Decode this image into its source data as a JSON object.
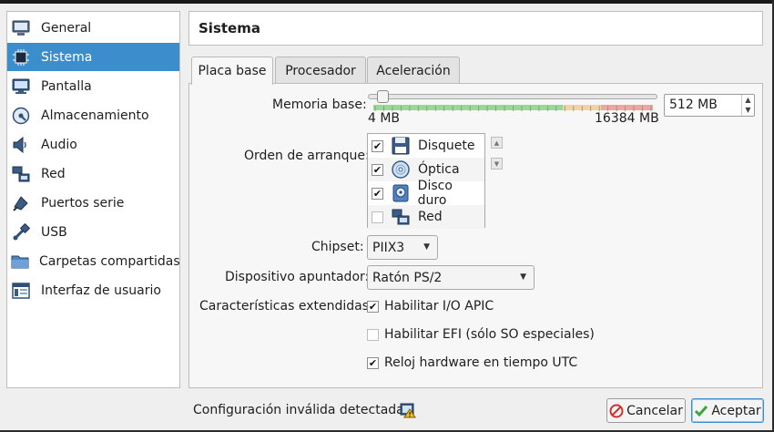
{
  "sidebar": {
    "items": [
      {
        "label": "General",
        "icon": "general-icon",
        "selected": false
      },
      {
        "label": "Sistema",
        "icon": "system-chip-icon",
        "selected": true
      },
      {
        "label": "Pantalla",
        "icon": "monitor-icon",
        "selected": false
      },
      {
        "label": "Almacenamiento",
        "icon": "storage-disk-icon",
        "selected": false
      },
      {
        "label": "Audio",
        "icon": "audio-speaker-icon",
        "selected": false
      },
      {
        "label": "Red",
        "icon": "network-icon",
        "selected": false
      },
      {
        "label": "Puertos serie",
        "icon": "serial-port-icon",
        "selected": false
      },
      {
        "label": "USB",
        "icon": "usb-icon",
        "selected": false
      },
      {
        "label": "Carpetas compartidas",
        "icon": "folder-icon",
        "selected": false
      },
      {
        "label": "Interfaz de usuario",
        "icon": "user-interface-icon",
        "selected": false
      }
    ]
  },
  "header": {
    "title": "Sistema"
  },
  "tabs": [
    {
      "label": "Placa base",
      "active": true
    },
    {
      "label": "Procesador",
      "active": false
    },
    {
      "label": "Aceleración",
      "active": false
    }
  ],
  "memory": {
    "label": "Memoria base:",
    "min_label": "4 MB",
    "max_label": "16384 MB",
    "value": "512 MB",
    "value_mb": 512,
    "min_mb": 4,
    "max_mb": 16384
  },
  "boot": {
    "label": "Orden de arranque:",
    "items": [
      {
        "label": "Disquete",
        "checked": true,
        "icon": "floppy-icon"
      },
      {
        "label": "Óptica",
        "checked": true,
        "icon": "optical-disc-icon"
      },
      {
        "label": "Disco duro",
        "checked": true,
        "icon": "hard-disk-icon"
      },
      {
        "label": "Red",
        "checked": false,
        "icon": "network-boot-icon"
      }
    ]
  },
  "chipset": {
    "label": "Chipset:",
    "value": "PIIX3"
  },
  "pointing": {
    "label": "Dispositivo apuntador:",
    "value": "Ratón PS/2"
  },
  "extended": {
    "label": "Características extendidas:",
    "options": [
      {
        "label": "Habilitar I/O APIC",
        "checked": true
      },
      {
        "label": "Habilitar EFI (sólo SO especiales)",
        "checked": false
      },
      {
        "label": "Reloj hardware en tiempo UTC",
        "checked": true
      }
    ]
  },
  "footer": {
    "status": "Configuración inválida detectada",
    "cancel": "Cancelar",
    "accept": "Aceptar"
  },
  "colors": {
    "selection": "#3c8dcc",
    "slider_green": "#9ad89a",
    "slider_amber": "#f2d3a3",
    "slider_red": "#f2a3a3"
  }
}
